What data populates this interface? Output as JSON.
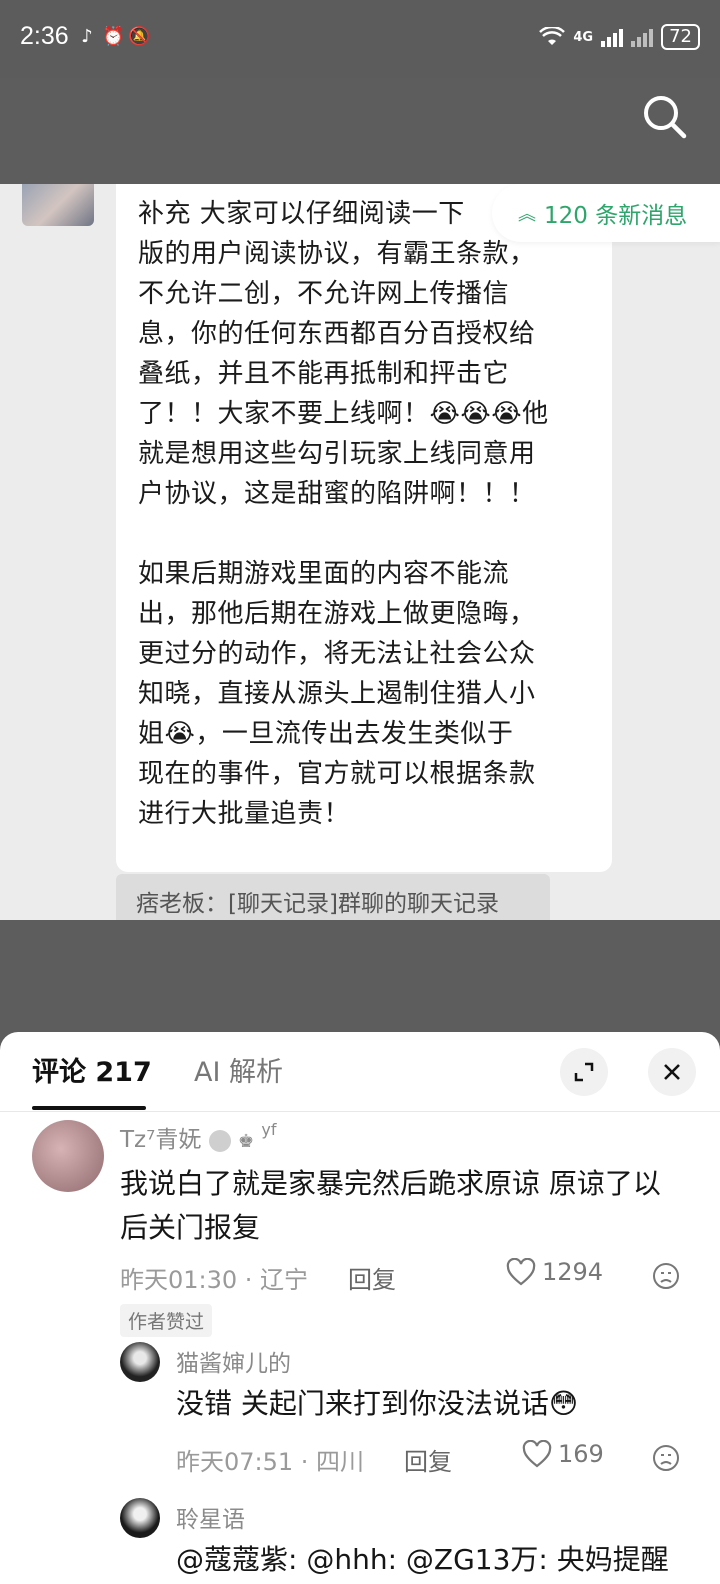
{
  "status_bar": {
    "time": "2:36",
    "network": "4G",
    "battery": "72"
  },
  "chat": {
    "new_messages": "120 条新消息",
    "message": "补充 大家可以仔细阅读一下\n版的用户阅读协议，有霸王条款，\n不允许二创，不允许网上传播信\n息，你的任何东西都百分百授权给\n叠纸，并且不能再抵制和抨击它\n了！！大家不要上线啊！😭😭😭他\n就是想用这些勾引玩家上线同意用\n户协议，这是甜蜜的陷阱啊！！！\n\n如果后期游戏里面的内容不能流\n出，那他后期在游戏上做更隐晦，\n更过分的动作，将无法让社会公众\n知晓，直接从源头上遏制住猎人小\n姐😭，一旦流传出去发生类似于\n现在的事件，官方就可以根据条款\n进行大批量追责！",
    "quote": "痞老板：[聊天记录]群聊的聊天记录"
  },
  "comments_panel": {
    "tab_comments": "评论 217",
    "tab_ai": "AI 解析",
    "comments": [
      {
        "user": "Tz⁷青妩",
        "user_suffix": "yf",
        "text": "我说白了就是家暴完然后跪求原谅  原谅了以后关门报复",
        "time_location": "昨天01:30 · 辽宁",
        "reply": "回复",
        "likes": "1294",
        "badge": "作者赞过"
      },
      {
        "user": "猫酱婶儿的",
        "text": "没错 关起门来打到你没法说话😳",
        "time_location": "昨天07:51 · 四川",
        "reply": "回复",
        "likes": "169"
      },
      {
        "user": "聆星语",
        "text": "@蔻蔻紫: @hhh: @ZG13万: 央妈提醒"
      }
    ]
  },
  "icons": {
    "search": "search-icon",
    "expand": "expand-icon",
    "close": "close-icon",
    "heart": "heart-icon",
    "dislike": "dislike-icon"
  }
}
